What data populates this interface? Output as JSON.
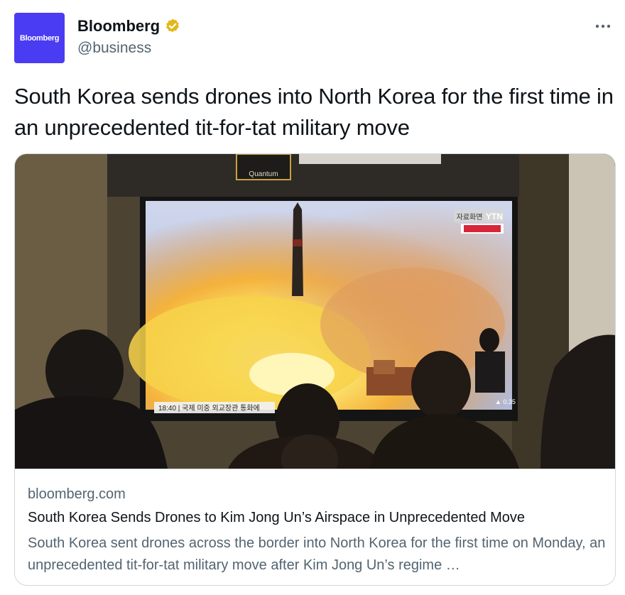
{
  "author": {
    "avatar_text": "Bloomberg",
    "display_name": "Bloomberg",
    "handle": "@business",
    "verified_icon": "verified-badge-icon",
    "avatar_color": "#4a3cf2",
    "badge_color": "#e2b719"
  },
  "tweet": {
    "text": "South Korea sends drones into North Korea for the first time in an unprecedented tit-for-tat military move"
  },
  "card": {
    "image_overlay": {
      "brand": "Quantum",
      "channel": "YTN",
      "archive_label": "자료화면",
      "caption": "18:40 | 국제  미중 외교장관 통화에",
      "ticker_value": "▲ 0.35"
    },
    "domain": "bloomberg.com",
    "title": "South Korea Sends Drones to Kim Jong Un’s Airspace in Unprecedented Move",
    "description": "South Korea sent drones across the border into North Korea for the first time on Monday, an unprecedented tit-for-tat military move after Kim Jong Un’s regime …"
  }
}
